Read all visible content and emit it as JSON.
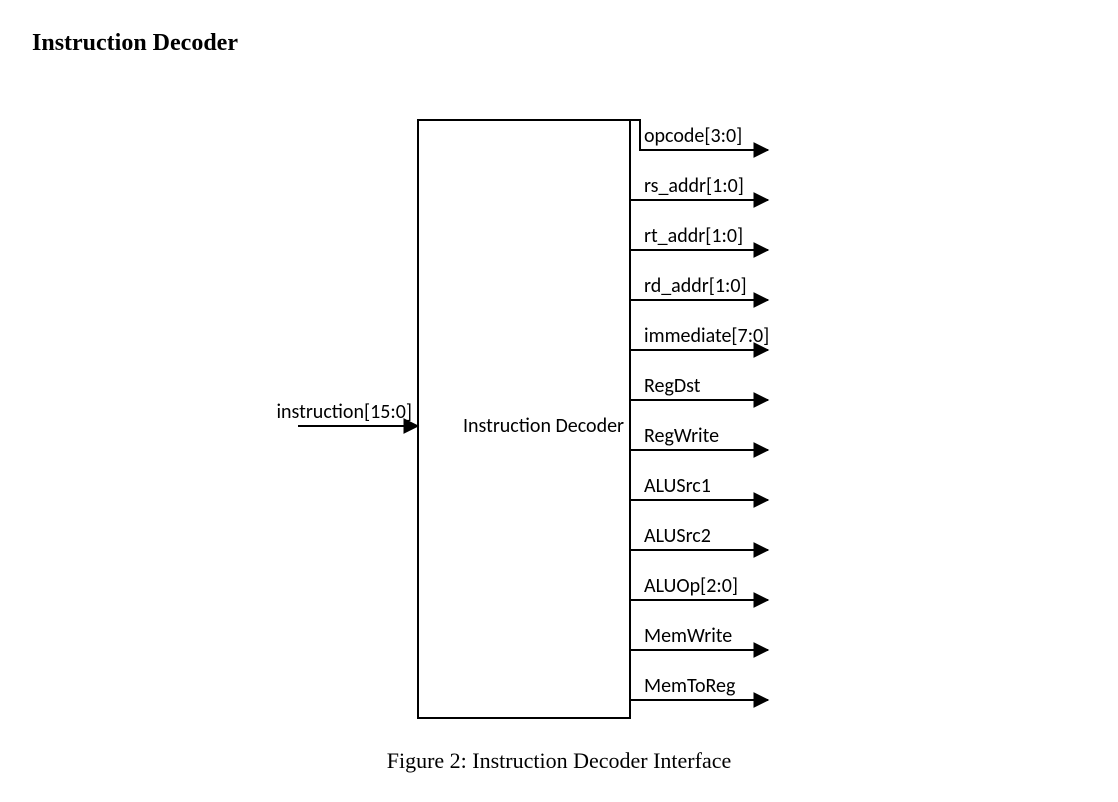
{
  "title": "Instruction Decoder",
  "block_label": "Instruction Decoder",
  "input_label": "instruction[15:0]",
  "outputs": [
    "opcode[3:0]",
    "rs_addr[1:0]",
    "rt_addr[1:0]",
    "rd_addr[1:0]",
    "immediate[7:0]",
    "RegDst",
    "RegWrite",
    "ALUSrc1",
    "ALUSrc2",
    "ALUOp[2:0]",
    "MemWrite",
    "MemToReg"
  ],
  "caption": "Figure 2: Instruction Decoder Interface"
}
